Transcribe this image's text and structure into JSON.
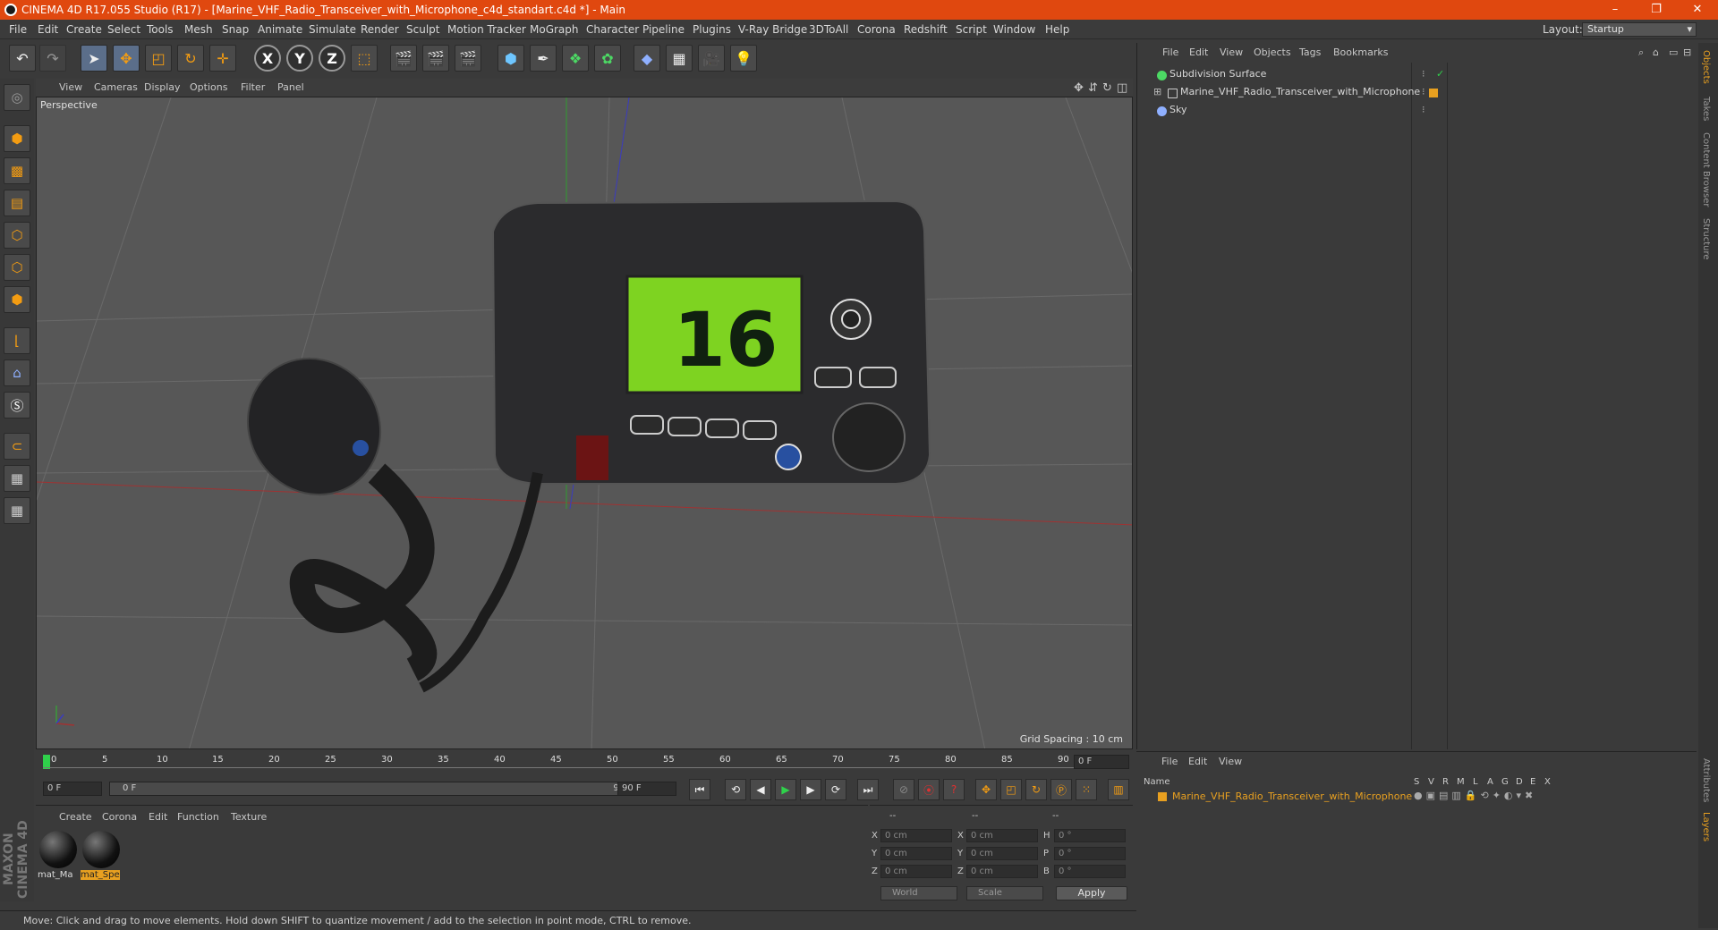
{
  "window": {
    "title": "CINEMA 4D R17.055 Studio (R17) - [Marine_VHF_Radio_Transceiver_with_Microphone_c4d_standart.c4d *] - Main",
    "minimize": "–",
    "maximize": "❐",
    "close": "✕"
  },
  "menubar": {
    "items": [
      "File",
      "Edit",
      "Create",
      "Select",
      "Tools",
      "Mesh",
      "Snap",
      "Animate",
      "Simulate",
      "Render",
      "Sculpt",
      "Motion Tracker",
      "MoGraph",
      "Character",
      "Pipeline",
      "Plugins",
      "V-Ray Bridge",
      "3DToAll",
      "Corona",
      "Redshift",
      "Script",
      "Window",
      "Help"
    ],
    "layout_label": "Layout:",
    "layout_value": "Startup"
  },
  "toolbar": {
    "x_label": "X",
    "y_label": "Y",
    "z_label": "Z"
  },
  "viewport": {
    "menu": [
      "View",
      "Cameras",
      "Display",
      "Options",
      "Filter",
      "Panel"
    ],
    "label": "Perspective",
    "grid_spacing": "Grid Spacing : 10 cm",
    "channel_display": "16"
  },
  "timeline": {
    "ticks": [
      "0",
      "5",
      "10",
      "15",
      "20",
      "25",
      "30",
      "35",
      "40",
      "45",
      "50",
      "55",
      "60",
      "65",
      "70",
      "75",
      "80",
      "85",
      "90"
    ],
    "current_frame": "0 F",
    "start_frame": "0 F",
    "range_start": "0 F",
    "range_end": "90 F",
    "end_frame": "90 F"
  },
  "materials": {
    "menu": [
      "Create",
      "Corona",
      "Edit",
      "Function",
      "Texture"
    ],
    "items": [
      {
        "label": "mat_Ma"
      },
      {
        "label": "mat_Spe"
      }
    ]
  },
  "coordinates": {
    "header": [
      "--",
      "--",
      "--"
    ],
    "rows": [
      {
        "l1": "X",
        "v1": "0 cm",
        "l2": "X",
        "v2": "0 cm",
        "l3": "H",
        "v3": "0 °"
      },
      {
        "l1": "Y",
        "v1": "0 cm",
        "l2": "Y",
        "v2": "0 cm",
        "l3": "P",
        "v3": "0 °"
      },
      {
        "l1": "Z",
        "v1": "0 cm",
        "l2": "Z",
        "v2": "0 cm",
        "l3": "B",
        "v3": "0 °"
      }
    ],
    "mode1": "World",
    "mode2": "Scale",
    "apply": "Apply"
  },
  "status": {
    "text": "Move: Click and drag to move elements. Hold down SHIFT to quantize movement / add to the selection in point mode, CTRL to remove."
  },
  "brand": {
    "logo_text": "MAXON CINEMA 4D"
  },
  "object_manager": {
    "menu": [
      "File",
      "Edit",
      "View",
      "Objects",
      "Tags",
      "Bookmarks"
    ],
    "objects": [
      {
        "name": "Subdivision Surface"
      },
      {
        "name": "Marine_VHF_Radio_Transceiver_with_Microphone"
      },
      {
        "name": "Sky"
      }
    ]
  },
  "right_tabs": [
    "Objects",
    "Takes",
    "Content Browser",
    "Structure",
    "Attributes",
    "Layers"
  ],
  "layer_manager": {
    "menu": [
      "File",
      "Edit",
      "View"
    ],
    "columns": [
      "Name",
      "S",
      "V",
      "R",
      "M",
      "L",
      "A",
      "G",
      "D",
      "E",
      "X"
    ],
    "layer_name": "Marine_VHF_Radio_Transceiver_with_Microphone"
  },
  "colors": {
    "title_bar": "#e0480f",
    "accent_orange": "#f39c12",
    "layer_text": "#e8a020",
    "lcd_green": "#7ed321"
  }
}
